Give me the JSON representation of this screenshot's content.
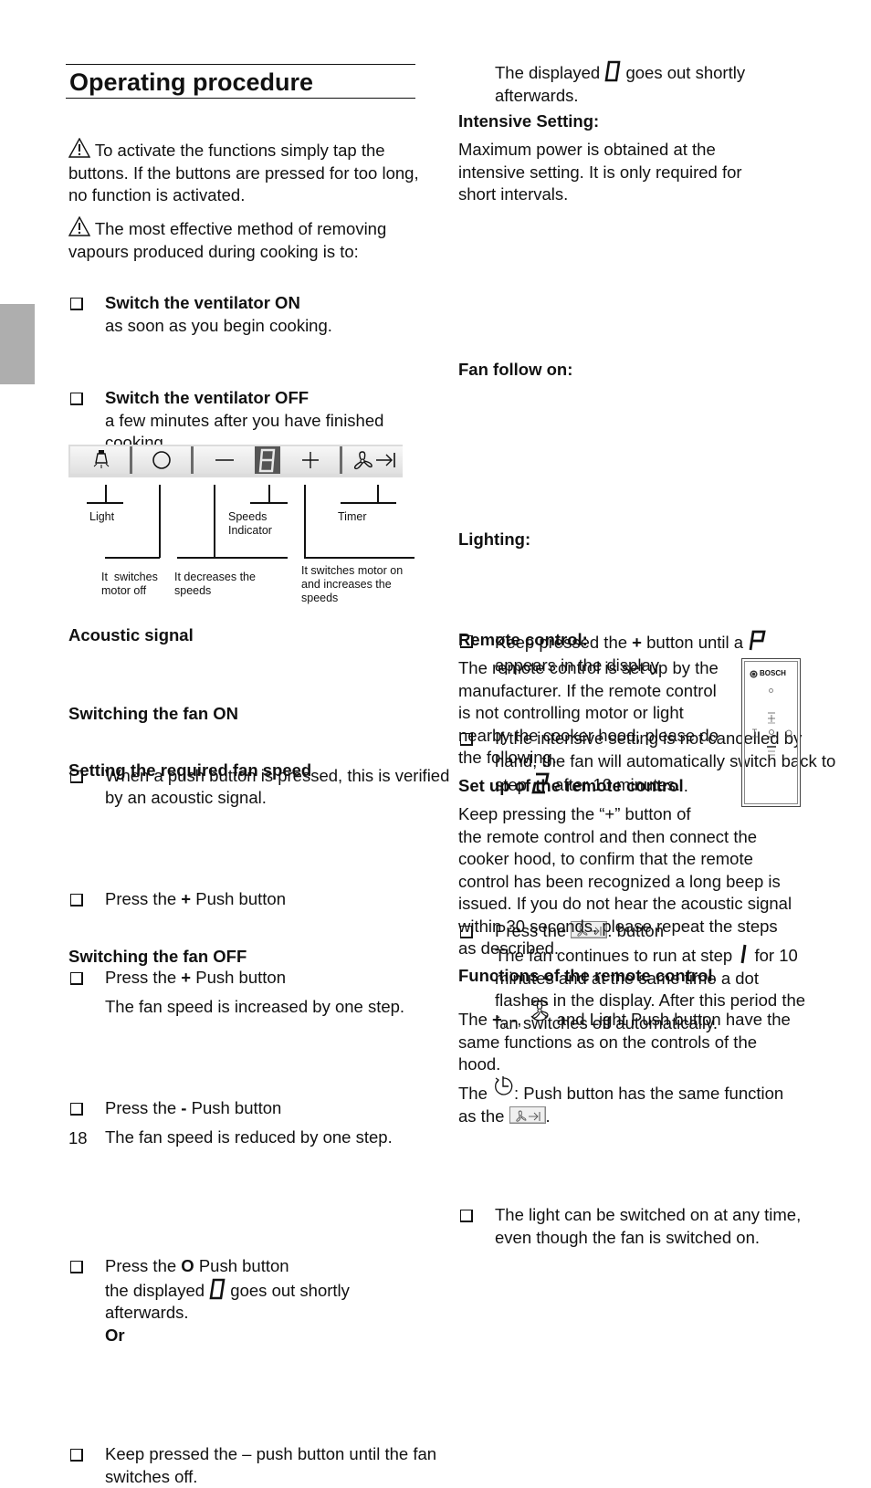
{
  "page": {
    "title": "Operating procedure",
    "page_number": "18"
  },
  "left": {
    "warning1": "To activate the functions simply tap the buttons. If the buttons are pressed for too long, no function is activated.",
    "warning2": "The most effective method of removing vapours produced during cooking is to:",
    "tips": [
      {
        "bold": "Switch the ventilator ON",
        "text": "as soon as you begin cooking."
      },
      {
        "bold": "Switch the ventilator OFF",
        "text": "a few minutes after you have finished cooking."
      }
    ],
    "panel_labels": {
      "light": "Light",
      "speeds_indicator_1": "Speeds",
      "speeds_indicator_2": "Indicator",
      "timer": "Timer",
      "off_1": "It  switches",
      "off_2": "motor off",
      "minus_1": "It decreases the",
      "minus_2": "speeds",
      "plus_1": "It switches motor on",
      "plus_2": "and increases the",
      "plus_3": "speeds"
    },
    "acoustic": {
      "heading": "Acoustic signal",
      "item": "When a push button is pressed, this is verified by an acoustic signal."
    },
    "fan_on": {
      "heading": "Switching the fan ON",
      "item_pre": "Press the ",
      "item_key": "+",
      "item_post": " Push button"
    },
    "fan_speed": {
      "heading": "Setting the required fan speed",
      "item1_pre": "Press the ",
      "item1_key": "+",
      "item1_post": " Push button",
      "item1_note": "The fan speed is increased by one step.",
      "item2_pre": "Press the ",
      "item2_key": "-",
      "item2_post": " Push button",
      "item2_note": "The fan speed is reduced by one step."
    },
    "fan_off": {
      "heading": "Switching the fan OFF",
      "item1_pre": "Press the ",
      "item1_key": "O",
      "item1_post": " Push button",
      "item1_l2_pre": "the displayed ",
      "item1_l2_post": " goes out shortly",
      "item1_l3": "afterwards.",
      "or": "Or",
      "item2": "Keep pressed the – push button until the fan switches off."
    }
  },
  "right": {
    "cont_pre": "The displayed ",
    "cont_post": " goes out shortly",
    "cont_l2": "afterwards.",
    "intensive": {
      "heading": "Intensive Setting:",
      "text": "Maximum power is obtained at the intensive setting. It is only required for short intervals.",
      "item1_pre": "Keep pressed the ",
      "item1_key": "+",
      "item1_post": " button until a ",
      "item1_l2": "appears in the display.",
      "item2_pre": "If the intensive setting is not cancelled by hand, the fan will automatically switch back to step ",
      "item2_post": " after 10 minutes."
    },
    "follow_on": {
      "heading": "Fan follow on:",
      "item_pre": "Press the ",
      "item_post": ". button",
      "l2_pre": "The fan continues to run at step ",
      "l2_post": " for 10 minutes and at the same time a dot flashes in the display. After this period the fan switches off automatically."
    },
    "lighting": {
      "heading": "Lighting:",
      "item": "The light can be switched on at any time, even though the fan is switched on."
    },
    "remote": {
      "heading": "Remote control:",
      "text": "The remote control is set up by the manufacturer. If the remote control is not controlling motor or light nearby the cooker hood, please do the following.",
      "brand": "BOSCH",
      "setup_heading": "Set up of the remote control",
      "setup_text_l1": "Keep pressing the “+” button of",
      "setup_text": "the remote control and then connect the cooker hood, to confirm that the remote control has been recognized a long beep is issued. If you do not hear the acoustic signal within 30 seconds, please repeat the steps as described.",
      "functions_heading": "Functions of the remote control",
      "func1_pre": "The ",
      "func1_plus": "+",
      "func1_sep1": ", ",
      "func1_minus": "-",
      "func1_sep2": ", ",
      "func1_post": " and Light Push button have the same functions as on the controls of the hood.",
      "func2_pre": "The ",
      "func2_mid": ": Push button has the same function as the ",
      "func2_end": "."
    }
  }
}
